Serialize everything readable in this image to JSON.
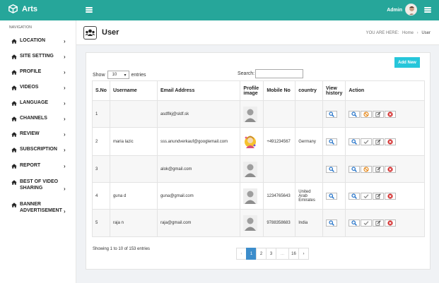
{
  "app": {
    "title": "Arts",
    "admin": "Admin"
  },
  "colors": {
    "brand": "#26a69a",
    "add_button": "#26c6da",
    "active_page": "#3c8dcb"
  },
  "sidebar": {
    "heading": "NAVIGATION",
    "items": [
      {
        "label": "LOCATION",
        "icon": "home-icon"
      },
      {
        "label": "SITE SETTING",
        "icon": "home-icon"
      },
      {
        "label": "PROFILE",
        "icon": "home-icon"
      },
      {
        "label": "VIDEOS",
        "icon": "home-icon"
      },
      {
        "label": "LANGUAGE",
        "icon": "home-icon"
      },
      {
        "label": "CHANNELS",
        "icon": "home-icon"
      },
      {
        "label": "REVIEW",
        "icon": "home-icon"
      },
      {
        "label": "SUBSCRIPTION",
        "icon": "home-icon"
      },
      {
        "label": "REPORT",
        "icon": "home-icon"
      },
      {
        "label": "BEST OF VIDEO SHARING",
        "icon": "home-icon"
      },
      {
        "label": "BANNER ADVERTISEMENT",
        "icon": "home-icon"
      }
    ]
  },
  "header": {
    "title": "User",
    "breadcrumb_prefix": "YOU ARE HERE:",
    "breadcrumb_home": "Home",
    "breadcrumb_sep": "›",
    "breadcrumb_current": "User"
  },
  "toolbar": {
    "add_label": "Add New",
    "show_label": "Show",
    "entries_value": "10",
    "entries_label": "entries",
    "search_label": "Search:",
    "search_value": ""
  },
  "table": {
    "columns": [
      "S.No",
      "Username",
      "Email Address",
      "Profile image",
      "Mobile No",
      "country",
      "View history",
      "Action"
    ],
    "rows": [
      {
        "sno": "1",
        "username": "",
        "email": "asdflkj@sldf.sk",
        "image": "default",
        "mobile": "",
        "country": "",
        "blocked_button": true
      },
      {
        "sno": "2",
        "username": "maria lazic",
        "email": "sss.anundverkauf@googlemail.com",
        "image": "custom",
        "mobile": "+491234567",
        "country": "Germany",
        "blocked_button": false
      },
      {
        "sno": "3",
        "username": "",
        "email": "alok@gmail.com",
        "image": "default",
        "mobile": "",
        "country": "",
        "blocked_button": true
      },
      {
        "sno": "4",
        "username": "guna d",
        "email": "guna@gmail.com",
        "image": "default",
        "mobile": "1234765643",
        "country": "United Arab Emirates",
        "blocked_button": false
      },
      {
        "sno": "5",
        "username": "raja n",
        "email": "raja@gmail.com",
        "image": "default",
        "mobile": "9788358683",
        "country": "India",
        "blocked_button": false
      }
    ]
  },
  "footer": {
    "info": "Showing 1 to 10 of 153 entries",
    "pages": [
      "‹",
      "1",
      "2",
      "3",
      "...",
      "16",
      "›"
    ],
    "active_page": "1"
  }
}
